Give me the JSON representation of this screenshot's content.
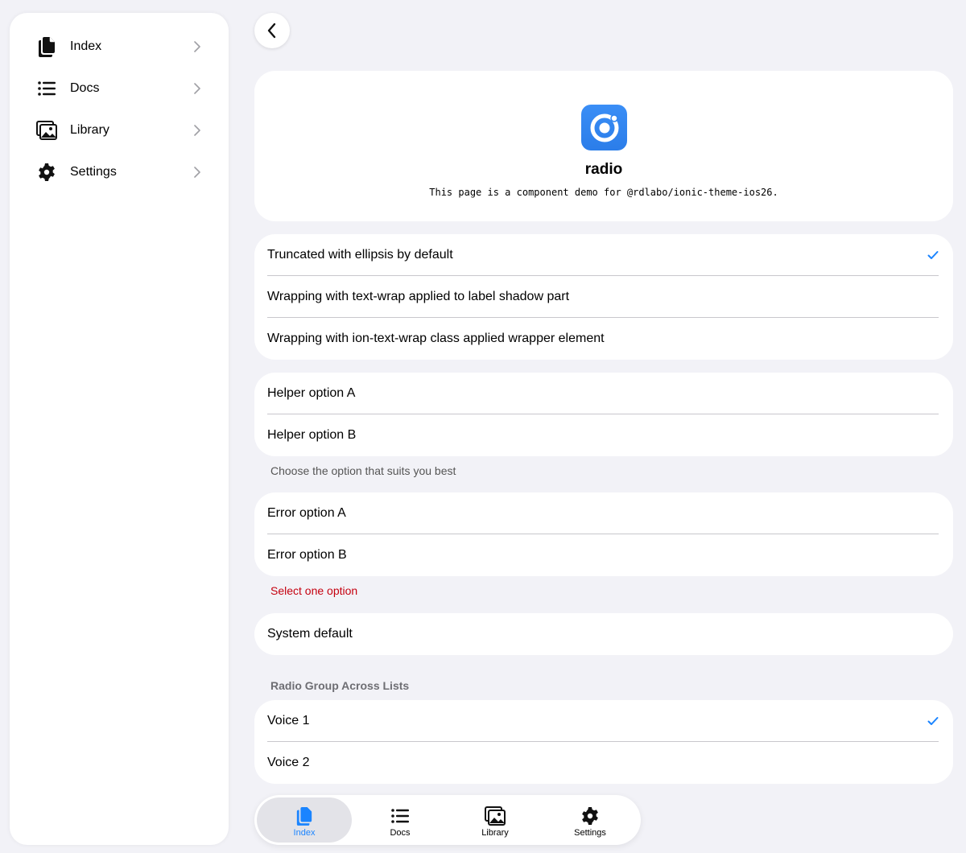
{
  "sidebar": {
    "items": [
      {
        "label": "Index",
        "icon": "documents-icon"
      },
      {
        "label": "Docs",
        "icon": "list-icon"
      },
      {
        "label": "Library",
        "icon": "images-icon"
      },
      {
        "label": "Settings",
        "icon": "gear-icon"
      }
    ]
  },
  "header": {
    "back_icon": "chevron-back-icon"
  },
  "hero": {
    "title": "radio",
    "subtitle": "This page is a component demo for @rdlabo/ionic-theme-ios26."
  },
  "group1": {
    "options": [
      {
        "label": "Truncated with ellipsis by default",
        "checked": true
      },
      {
        "label": "Wrapping with text-wrap applied to label shadow part",
        "checked": false
      },
      {
        "label": "Wrapping with ion-text-wrap class applied wrapper element",
        "checked": false
      }
    ]
  },
  "helper_group": {
    "options": [
      {
        "label": "Helper option A"
      },
      {
        "label": "Helper option B"
      }
    ],
    "helper_text": "Choose the option that suits you best"
  },
  "error_group": {
    "options": [
      {
        "label": "Error option A"
      },
      {
        "label": "Error option B"
      }
    ],
    "error_text": "Select one option"
  },
  "system_group": {
    "options": [
      {
        "label": "System default"
      }
    ]
  },
  "across_lists": {
    "header": "Radio Group Across Lists",
    "options": [
      {
        "label": "Voice 1",
        "checked": true
      },
      {
        "label": "Voice 2",
        "checked": false
      }
    ]
  },
  "tabbar": {
    "tabs": [
      {
        "label": "Index",
        "active": true
      },
      {
        "label": "Docs",
        "active": false
      },
      {
        "label": "Library",
        "active": false
      },
      {
        "label": "Settings",
        "active": false
      }
    ]
  },
  "colors": {
    "accent": "#1a84ff",
    "error": "#c5000f",
    "background": "#f2f2f7",
    "app_icon": "#2f84f0"
  }
}
